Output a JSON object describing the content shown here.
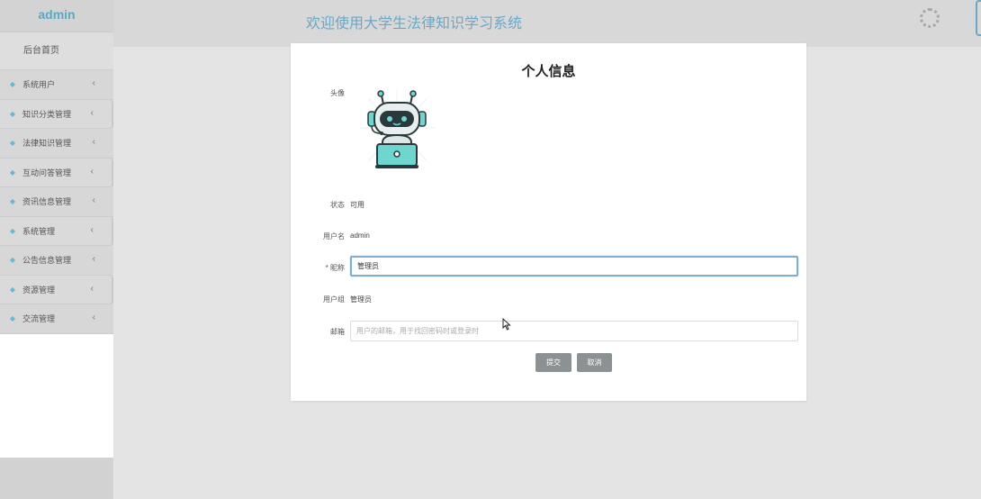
{
  "sidebar": {
    "brand": "admin",
    "home": "后台首页",
    "items": [
      {
        "label": "系统用户"
      },
      {
        "label": "知识分类管理"
      },
      {
        "label": "法律知识管理"
      },
      {
        "label": "互动问答管理"
      },
      {
        "label": "资讯信息管理"
      },
      {
        "label": "系统管理"
      },
      {
        "label": "公告信息管理"
      },
      {
        "label": "资源管理"
      },
      {
        "label": "交流管理"
      }
    ],
    "item_icon": "diamond-icon",
    "chevron_icon": "chevron-left-icon"
  },
  "header": {
    "title": "欢迎使用大学生法律知识学习系统",
    "spinner_icon": "loading-spinner-icon"
  },
  "profile": {
    "title": "个人信息",
    "avatar_label": "头像",
    "status_label": "状态",
    "status_value": "可用",
    "username_label": "用户名",
    "username_value": "admin",
    "nickname_label": "* 昵称",
    "nickname_value": "管理员",
    "group_label": "用户组",
    "group_value": "管理员",
    "email_label": "邮箱",
    "email_placeholder": "用户的邮箱，用于找回密码时或登录时",
    "submit_label": "提交",
    "cancel_label": "取消"
  },
  "colors": {
    "accent": "#6aa8c5",
    "button": "#8c9194",
    "sidebar_bg": "#d7d7d7",
    "page_bg": "#e4e4e4"
  }
}
